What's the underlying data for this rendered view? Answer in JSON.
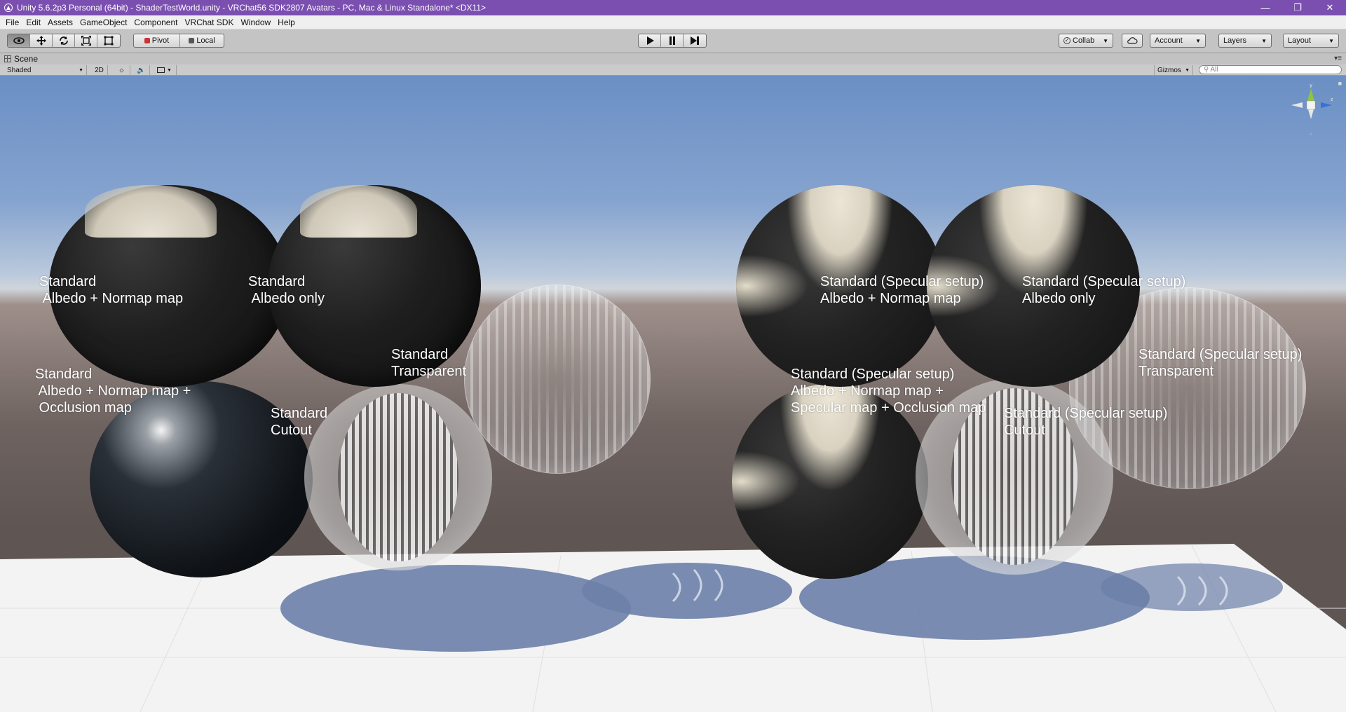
{
  "window": {
    "title": "Unity 5.6.2p3 Personal (64bit) - ShaderTestWorld.unity - VRChat56 SDK2807 Avatars - PC, Mac & Linux Standalone* <DX11>",
    "controls": [
      "minimize-icon",
      "restore-icon",
      "close-icon"
    ]
  },
  "menu": [
    "File",
    "Edit",
    "Assets",
    "GameObject",
    "Component",
    "VRChat SDK",
    "Window",
    "Help"
  ],
  "toolbar": {
    "transform_tools": [
      "hand-icon",
      "move-icon",
      "rotate-icon",
      "scale-icon",
      "rect-icon"
    ],
    "pivot_label": "Pivot",
    "local_label": "Local",
    "collab_label": "Collab",
    "account_label": "Account",
    "layers_label": "Layers",
    "layout_label": "Layout"
  },
  "scene": {
    "tab_label": "Scene",
    "shading_mode": "Shaded",
    "mode_2d": "2D",
    "gizmos_label": "Gizmos",
    "search_placeholder": "All"
  },
  "viewport": {
    "labels": [
      "Standard\n Albedo + Normap map",
      "Standard\n Albedo only",
      "Standard (Specular setup)\nAlbedo + Normap map",
      "Standard (Specular setup)\nAlbedo only",
      "Standard\n Albedo + Normap map +\n Occlusion map",
      "Standard\nTransparent",
      "Standard\nCutout",
      "Standard (Specular setup)\nAlbedo + Normap map +\nSpecular map + Occlusion map",
      "Standard (Specular setup)\nCutout",
      "Standard (Specular setup)\nTransparent"
    ]
  },
  "colors": {
    "titlebar": "#7b4fb0",
    "menubar": "#efefef",
    "toolbar": "#c4c4c4",
    "sky_top": "#6b8fc4",
    "ground": "#6e6360",
    "floor": "#f4f4f4",
    "shadow": "#6b7fa8"
  }
}
